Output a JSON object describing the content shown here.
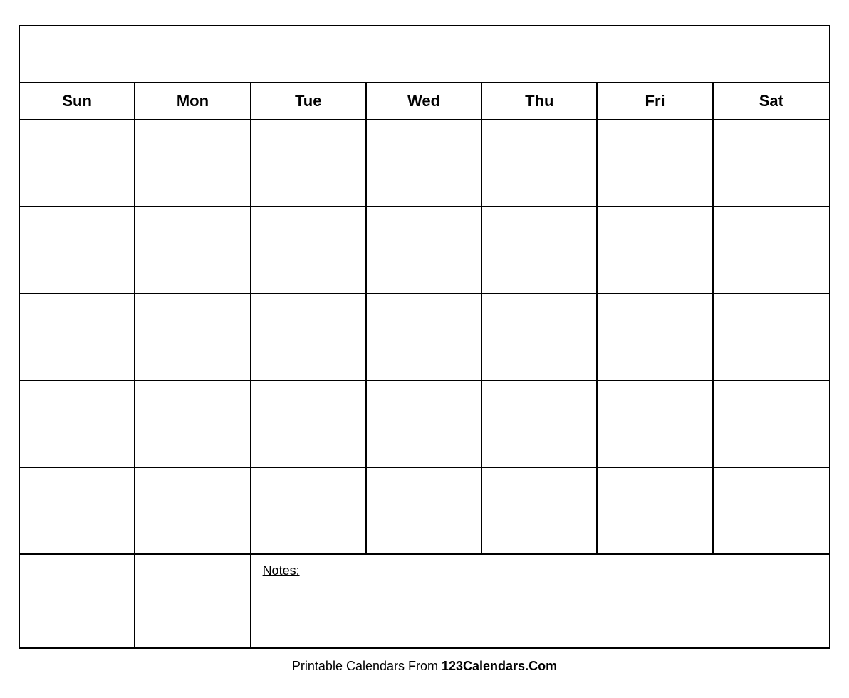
{
  "calendar": {
    "title": "",
    "days": [
      "Sun",
      "Mon",
      "Tue",
      "Wed",
      "Thu",
      "Fri",
      "Sat"
    ],
    "rows": 5,
    "notes_label": "Notes:"
  },
  "footer": {
    "text_before": "Printable Calendars From ",
    "brand": "123Calendars.Com"
  }
}
